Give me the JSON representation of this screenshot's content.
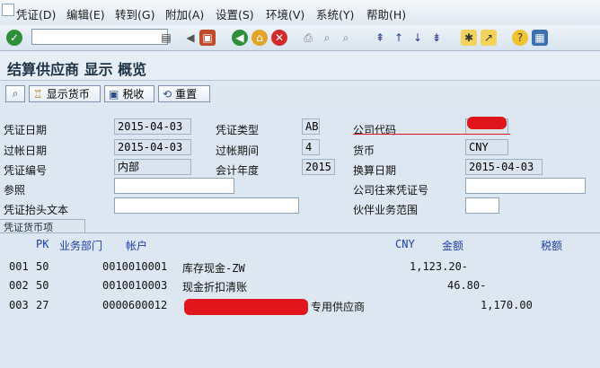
{
  "menu": {
    "items": [
      "凭证(D)",
      "编辑(E)",
      "转到(G)",
      "附加(A)",
      "设置(S)",
      "环境(V)",
      "系统(Y)",
      "帮助(H)"
    ]
  },
  "toolbar": {
    "command_value": ""
  },
  "page": {
    "title": "结算供应商 显示 概览"
  },
  "appbar": {
    "currency_label": "显示货币",
    "tax_label": "税收",
    "reset_label": "重置"
  },
  "header": {
    "doc_date_label": "凭证日期",
    "doc_date": "2015-04-03",
    "post_date_label": "过帐日期",
    "post_date": "2015-04-03",
    "doc_no_label": "凭证编号",
    "doc_no": "内部",
    "ref_label": "参照",
    "ref": "",
    "header_text_label": "凭证抬头文本",
    "header_text": "",
    "doc_type_label": "凭证类型",
    "doc_type": "AB",
    "period_label": "过帐期间",
    "period": "4",
    "fiscal_year_label": "会计年度",
    "fiscal_year": "2015",
    "company_code_label": "公司代码",
    "company_code": "",
    "currency_label": "货币",
    "currency": "CNY",
    "translation_date_label": "换算日期",
    "translation_date": "2015-04-03",
    "intercompany_label": "公司往来凭证号",
    "intercompany": "",
    "trading_partner_label": "伙伴业务范围",
    "trading_partner": ""
  },
  "items": {
    "tab_label": "凭证货币项",
    "col_pk": "PK",
    "col_ba": "业务部门",
    "col_account": "帐户",
    "col_currency": "CNY",
    "col_amount": "金额",
    "col_tax": "税额",
    "rows": [
      {
        "no": "001",
        "pk": "50",
        "account": "0010010001",
        "text": "库存现金-ZW",
        "amount": "1,123.20-"
      },
      {
        "no": "002",
        "pk": "50",
        "account": "0010010003",
        "text": "现金折扣清账",
        "amount": "46.80-"
      },
      {
        "no": "003",
        "pk": "27",
        "account": "0000600012",
        "text": "专用供应商",
        "amount": "1,170.00"
      }
    ]
  }
}
